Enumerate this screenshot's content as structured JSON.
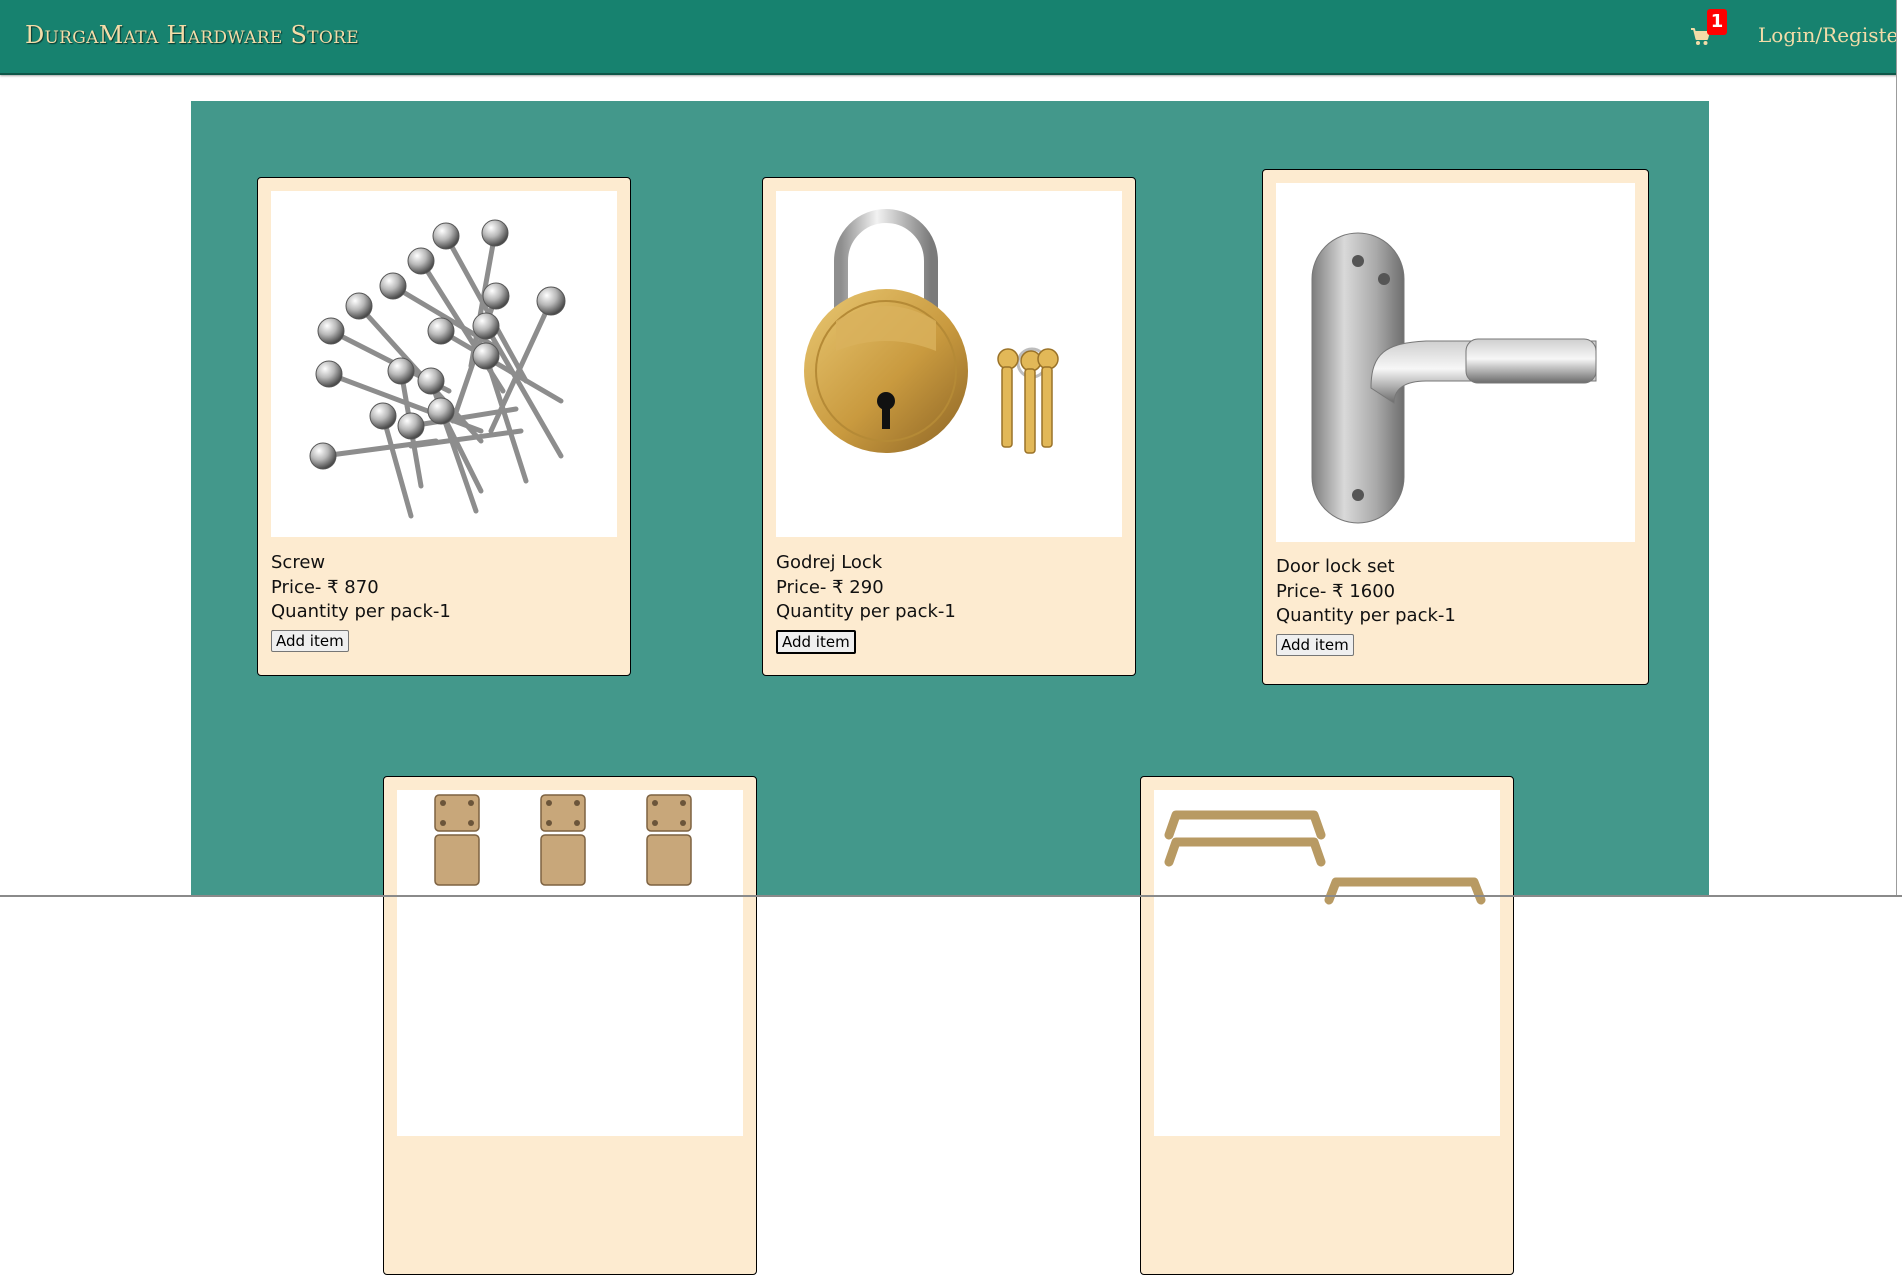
{
  "header": {
    "brand": "DurgaMata Hardware Store",
    "cart_count": "1",
    "login_label": "Login/Register",
    "cart_icon": "shopping-cart-icon"
  },
  "products": [
    {
      "name": "Screw",
      "price": "Price- ₹ 870",
      "quantity": "Quantity per pack-1",
      "button": "Add item",
      "image": "screws-image"
    },
    {
      "name": "Godrej Lock",
      "price": "Price- ₹ 290",
      "quantity": "Quantity per pack-1",
      "button": "Add item",
      "image": "padlock-with-keys-image"
    },
    {
      "name": "Door lock set",
      "price": "Price- ₹ 1600",
      "quantity": "Quantity per pack-1",
      "button": "Add item",
      "image": "door-handle-image"
    },
    {
      "name": "",
      "image": "tower-bolts-image"
    },
    {
      "name": "",
      "image": "cabinet-handles-image"
    }
  ],
  "colors": {
    "navbar": "#17826f",
    "panel": "#43988b",
    "card": "#fdebd0",
    "brand_text": "#f3dca8",
    "badge": "#ff0000"
  }
}
